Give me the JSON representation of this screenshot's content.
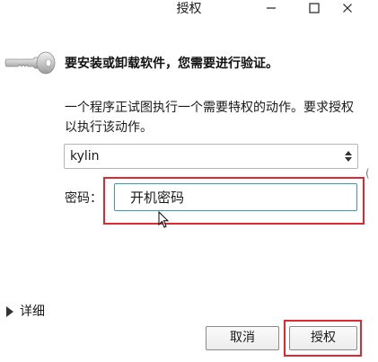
{
  "window": {
    "title": "授权",
    "minimize_icon": "minimize-icon",
    "maximize_icon": "maximize-icon",
    "close_icon": "close-icon"
  },
  "dialog": {
    "icon": "key-icon",
    "heading": "要安装或卸载软件，您需要进行验证。",
    "description": "一个程序正试图执行一个需要特权的动作。要求授权以执行该动作。",
    "user_select": {
      "value": "kylin",
      "icon": "spin-arrows-icon"
    },
    "password": {
      "label": "密码：",
      "value": "开机密码"
    },
    "details": {
      "label": "详细",
      "icon": "expander-arrow-icon"
    },
    "buttons": {
      "cancel": "取消",
      "authorize": "授权"
    }
  },
  "colors": {
    "highlight": "#e0282e",
    "input_focus_border": "#3a9ea6",
    "background": "#ffffff"
  }
}
